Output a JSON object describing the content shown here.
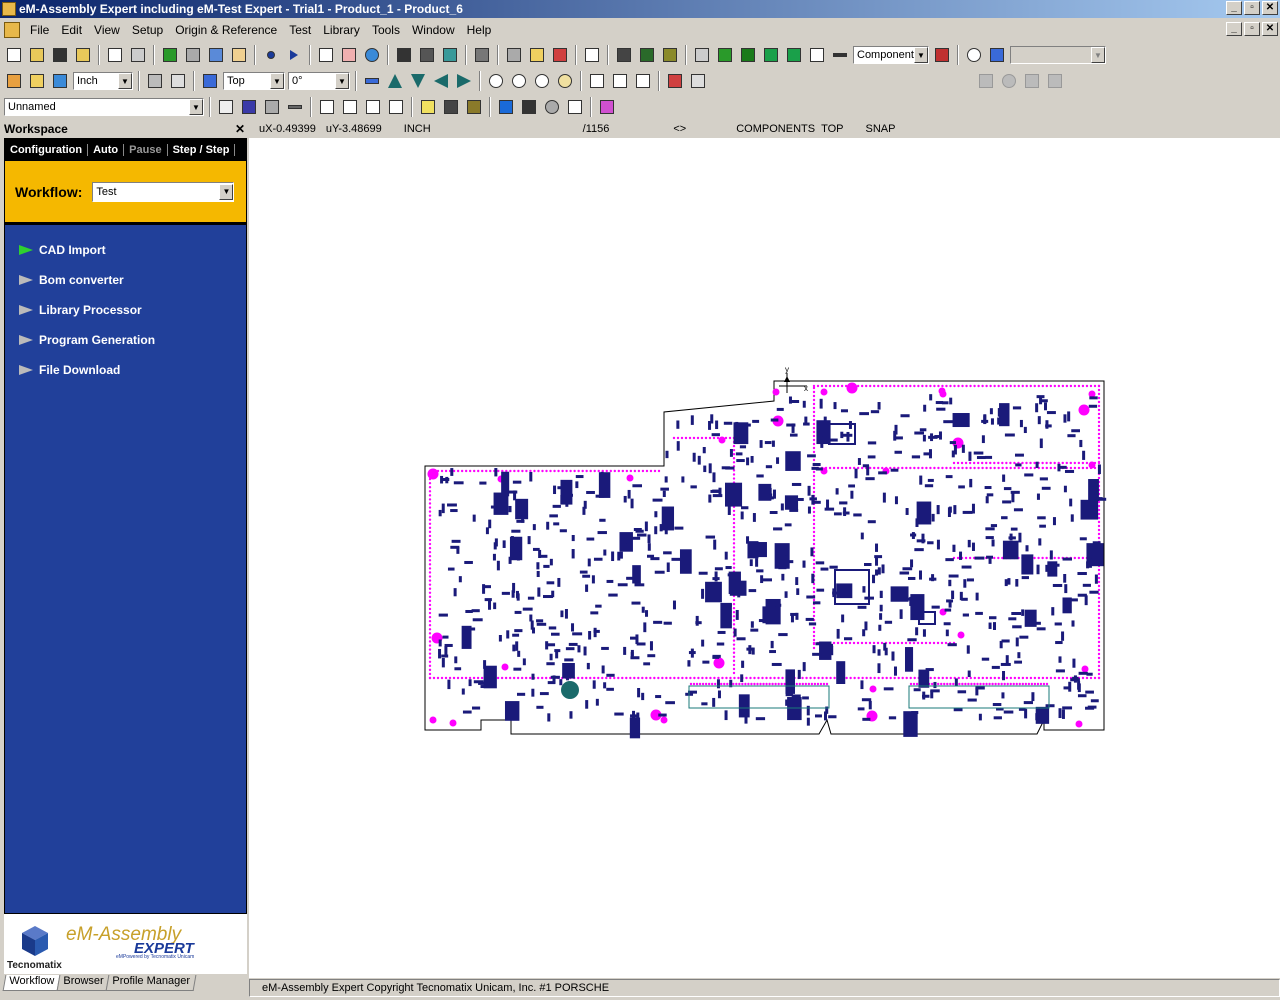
{
  "titlebar": {
    "title": "eM-Assembly Expert including eM-Test Expert - Trial1 - Product_1 - Product_6",
    "buttons": [
      "_",
      "▫",
      "✕"
    ]
  },
  "menubar": {
    "items": [
      "File",
      "Edit",
      "View",
      "Setup",
      "Origin & Reference",
      "Test",
      "Library",
      "Tools",
      "Window",
      "Help"
    ],
    "mdi_buttons": [
      "_",
      "▫",
      "✕"
    ]
  },
  "toolbar1": {
    "component_combo": "Component"
  },
  "toolbar2": {
    "units_combo": "Inch",
    "side_combo": "Top",
    "angle_combo": "0°"
  },
  "toolbar3": {
    "layer_combo": "Unnamed"
  },
  "workspace": {
    "header": "Workspace",
    "close_label": "✕",
    "tabs": [
      "Configuration",
      "Auto",
      "Pause",
      "Step / Step"
    ],
    "workflow_label": "Workflow:",
    "workflow_value": "Test",
    "steps": [
      "CAD Import",
      "Bom converter",
      "Library Processor",
      "Program Generation",
      "File Download"
    ],
    "bottom_tabs": [
      "Workflow",
      "Browser",
      "Profile Manager"
    ]
  },
  "logo": {
    "title": "eM-Assembly",
    "subtitle": "EXPERT",
    "tagline": "eMPowered by Tecnomatix Unicam",
    "company": "Tecnomatix"
  },
  "status_line": {
    "ux": "uX-0.49399",
    "uy": "uY-3.48699",
    "units": "INCH",
    "count": "/1156",
    "arrows": "<>",
    "layer": "COMPONENTS",
    "side": "TOP",
    "snap": "SNAP"
  },
  "statusbar": {
    "text": "eM-Assembly Expert Copyright Tecnomatix Unicam, Inc.  #1 PORSCHE"
  },
  "colors": {
    "title_start": "#0a246a",
    "title_end": "#a6caf0",
    "workspace_bg": "#21409a",
    "workflow_box": "#f5b800",
    "pcb_pad": "#ff00ff",
    "pcb_component": "#1a1a7a",
    "pcb_outline": "#000000"
  }
}
